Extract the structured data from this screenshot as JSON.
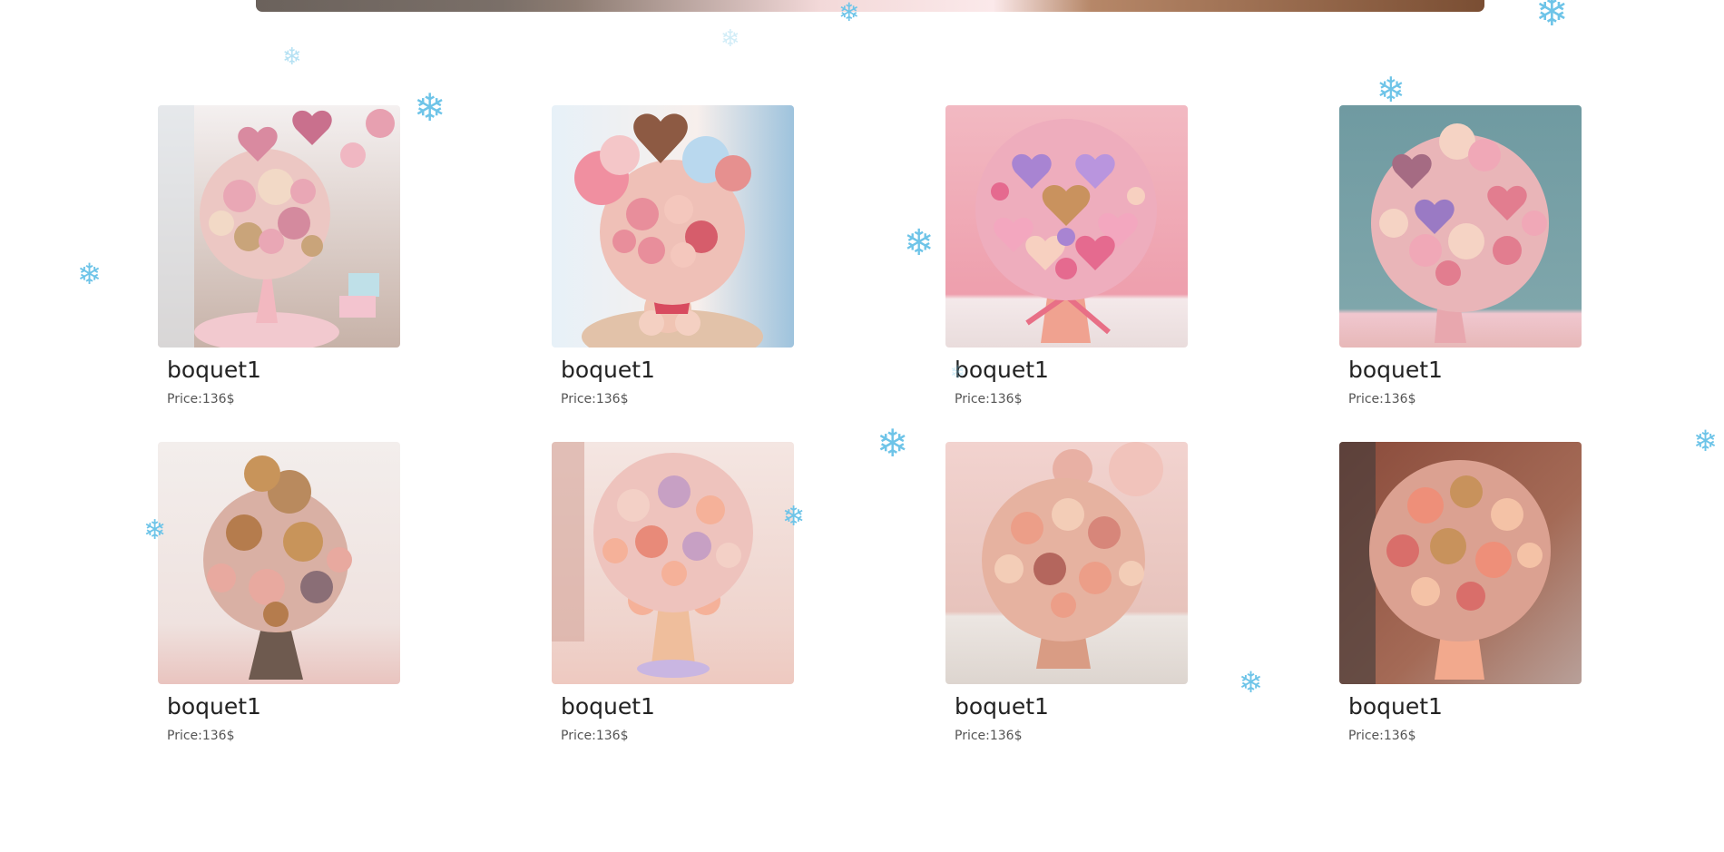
{
  "colors": {
    "snowflake": "#6ec4e8",
    "title": "#222222",
    "price": "#555555",
    "background": "#ffffff"
  },
  "products": [
    {
      "title": "boquet1",
      "price": "Price:136$",
      "image": "bouquet-hearts-balloons-window",
      "bg": [
        "#f4f0f0",
        "#c7b2a8"
      ],
      "flowers": [
        "#e9a7b5",
        "#f2d9c6",
        "#d48a9e",
        "#c9a47a"
      ]
    },
    {
      "title": "boquet1",
      "price": "Price:136$",
      "image": "bouquet-chocolate-heart-balloon",
      "bg": [
        "#e7f1f8",
        "#f1d9cf"
      ],
      "flowers": [
        "#e88e9b",
        "#f4c7bd",
        "#8d5a43",
        "#d65d6b"
      ]
    },
    {
      "title": "boquet1",
      "price": "Price:136$",
      "image": "bouquet-purple-pink-hearts",
      "bg": [
        "#f2b9c2",
        "#e99ba9"
      ],
      "flowers": [
        "#f3a7bf",
        "#a884d2",
        "#e56a8f",
        "#f7d0c0"
      ]
    },
    {
      "title": "boquet1",
      "price": "Price:136$",
      "image": "bouquet-teal-wall-hearts",
      "bg": [
        "#6f9aa1",
        "#e7b8b8"
      ],
      "flowers": [
        "#f0a8b7",
        "#f5d3c4",
        "#a56b83",
        "#e27d8f"
      ]
    },
    {
      "title": "boquet1",
      "price": "Price:136$",
      "image": "bouquet-gold-ornaments-bow",
      "bg": [
        "#efe7e4",
        "#e9c9c4"
      ],
      "flowers": [
        "#c8945a",
        "#e8a99f",
        "#b57c4d",
        "#8a6e76"
      ]
    },
    {
      "title": "boquet1",
      "price": "Price:136$",
      "image": "bouquet-peach-balloon-base",
      "bg": [
        "#f4e6e2",
        "#eec9c0"
      ],
      "flowers": [
        "#f5b199",
        "#c7a0c4",
        "#f3d0c6",
        "#e88a79"
      ]
    },
    {
      "title": "boquet1",
      "price": "Price:136$",
      "image": "bouquet-peach-roses-table",
      "bg": [
        "#f2d3cf",
        "#d5a493"
      ],
      "flowers": [
        "#ec9e88",
        "#f3cdb7",
        "#d7867a",
        "#b4665d"
      ]
    },
    {
      "title": "boquet1",
      "price": "Price:136$",
      "image": "bouquet-street-coral",
      "bg": [
        "#8a4b3b",
        "#b87a64"
      ],
      "flowers": [
        "#ee8f79",
        "#f4c2a6",
        "#d96e6a",
        "#c8925c"
      ]
    }
  ]
}
